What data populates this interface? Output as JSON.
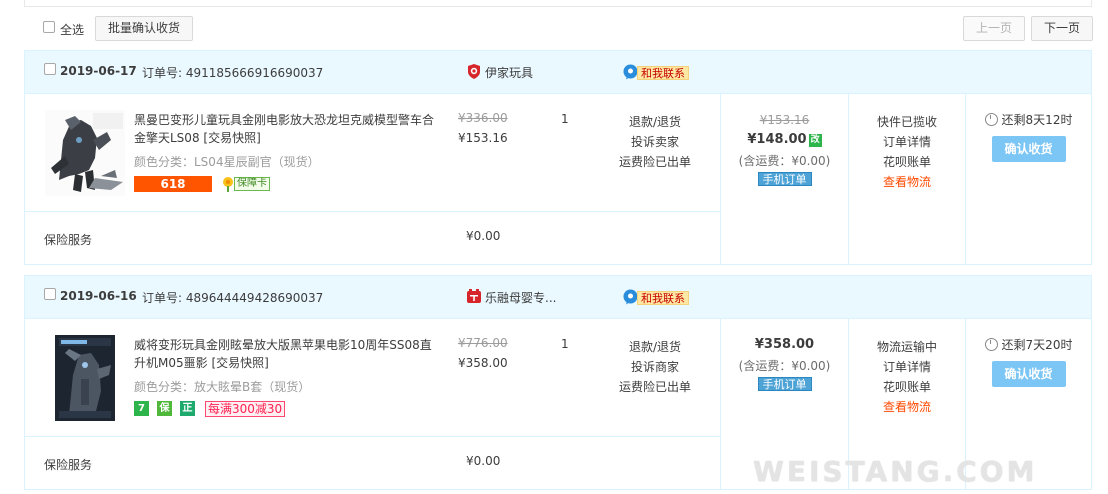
{
  "toolbar": {
    "select_all_label": "全选",
    "batch_confirm_label": "批量确认收货",
    "prev_page_label": "上一页",
    "next_page_label": "下一页"
  },
  "orders": [
    {
      "date": "2019-06-17",
      "order_no_label": "订单号: 491185666916690037",
      "shop_name": "伊家玩具",
      "contact_label": "和我联系",
      "item_title": "黑曼巴变形儿童玩具金刚电影放大恐龙坦克威模型警车合金擎天LS08 [交易快照]",
      "item_sku": "颜色分类：LS04星辰副官（现货）",
      "badge_618": "618",
      "badge_card": "保障卡",
      "orig_price": "¥336.00",
      "cur_price": "¥153.16",
      "qty": "1",
      "services": [
        "退款/退货",
        "投诉卖家",
        "运费险已出单"
      ],
      "insurance_label": "保险服务",
      "insurance_price": "¥0.00",
      "pay_orig": "¥153.16",
      "pay_real": "¥148.00",
      "pay_tag": "改",
      "pay_sub": "(含运费：¥0.00)",
      "mobile_tag": "手机订单",
      "status": [
        "快件已揽收",
        "订单详情",
        "花呗账单"
      ],
      "logistics_link": "查看物流",
      "countdown": "还剩8天12时",
      "confirm_label": "确认收货"
    },
    {
      "date": "2019-06-16",
      "order_no_label": "订单号: 489644449428690037",
      "shop_name": "乐融母婴专...",
      "contact_label": "和我联系",
      "item_title": "威将变形玩具金刚眩晕放大版黑苹果电影10周年SS08直升机M05噩影 [交易快照]",
      "item_sku": "颜色分类：放大眩晕B套（现货）",
      "badge_icons": [
        "7",
        "保",
        "正"
      ],
      "promo": "每满300减30",
      "orig_price": "¥776.00",
      "cur_price": "¥358.00",
      "qty": "1",
      "services": [
        "退款/退货",
        "投诉商家",
        "运费险已出单"
      ],
      "insurance_label": "保险服务",
      "insurance_price": "¥0.00",
      "pay_real": "¥358.00",
      "pay_sub": "(含运费：¥0.00)",
      "mobile_tag": "手机订单",
      "status": [
        "物流运输中",
        "订单详情",
        "花呗账单"
      ],
      "logistics_link": "查看物流",
      "countdown": "还剩7天20时",
      "confirm_label": "确认收货"
    }
  ],
  "watermark": "WEISTANG.COM",
  "colors": {
    "header_bg": "#eaf8ff",
    "border": "#daf3ff",
    "accent_orange": "#ff4a00",
    "confirm_btn": "#7cc6f6",
    "price_red": "#c40000"
  }
}
